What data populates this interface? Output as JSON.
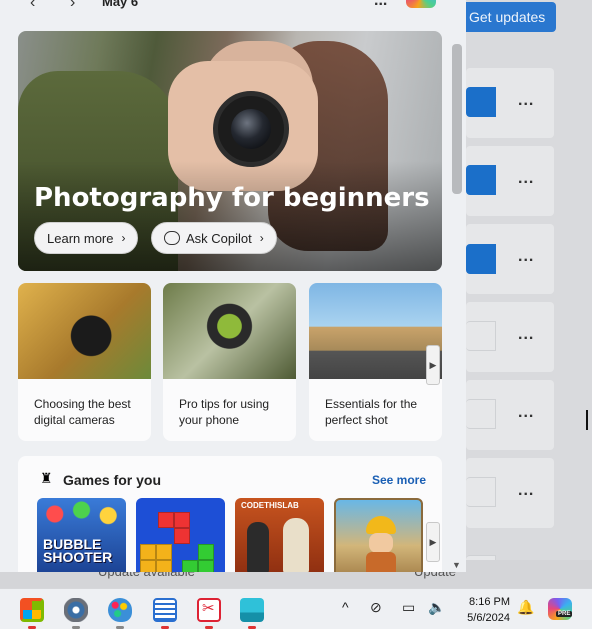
{
  "background_app": {
    "get_updates_label": "Get updates",
    "more_label": "...",
    "bottom_left_text": "Update available",
    "bottom_right_text": "Update"
  },
  "widgets": {
    "nav_back": "‹",
    "nav_forward": "›",
    "date": "May 6",
    "more": "...",
    "hero": {
      "title": "Photography for beginners",
      "learn_more": "Learn more",
      "ask_copilot": "Ask Copilot",
      "chevron": "›"
    },
    "cards": [
      {
        "caption": "Choosing the best digital cameras"
      },
      {
        "caption": "Pro tips for using your phone"
      },
      {
        "caption": "Essentials for the perfect shot"
      }
    ],
    "games": {
      "title": "Games for you",
      "see_more": "See more",
      "tile1_text": "BUBBLE SHOOTER",
      "tile3_brand": "CODETHISLAB"
    },
    "arrow_right": "▶",
    "scroll_down": "▼"
  },
  "taskbar": {
    "time": "8:16 PM",
    "date": "5/6/2024",
    "tray_chevron": "^",
    "pre_badge": "PRE"
  }
}
